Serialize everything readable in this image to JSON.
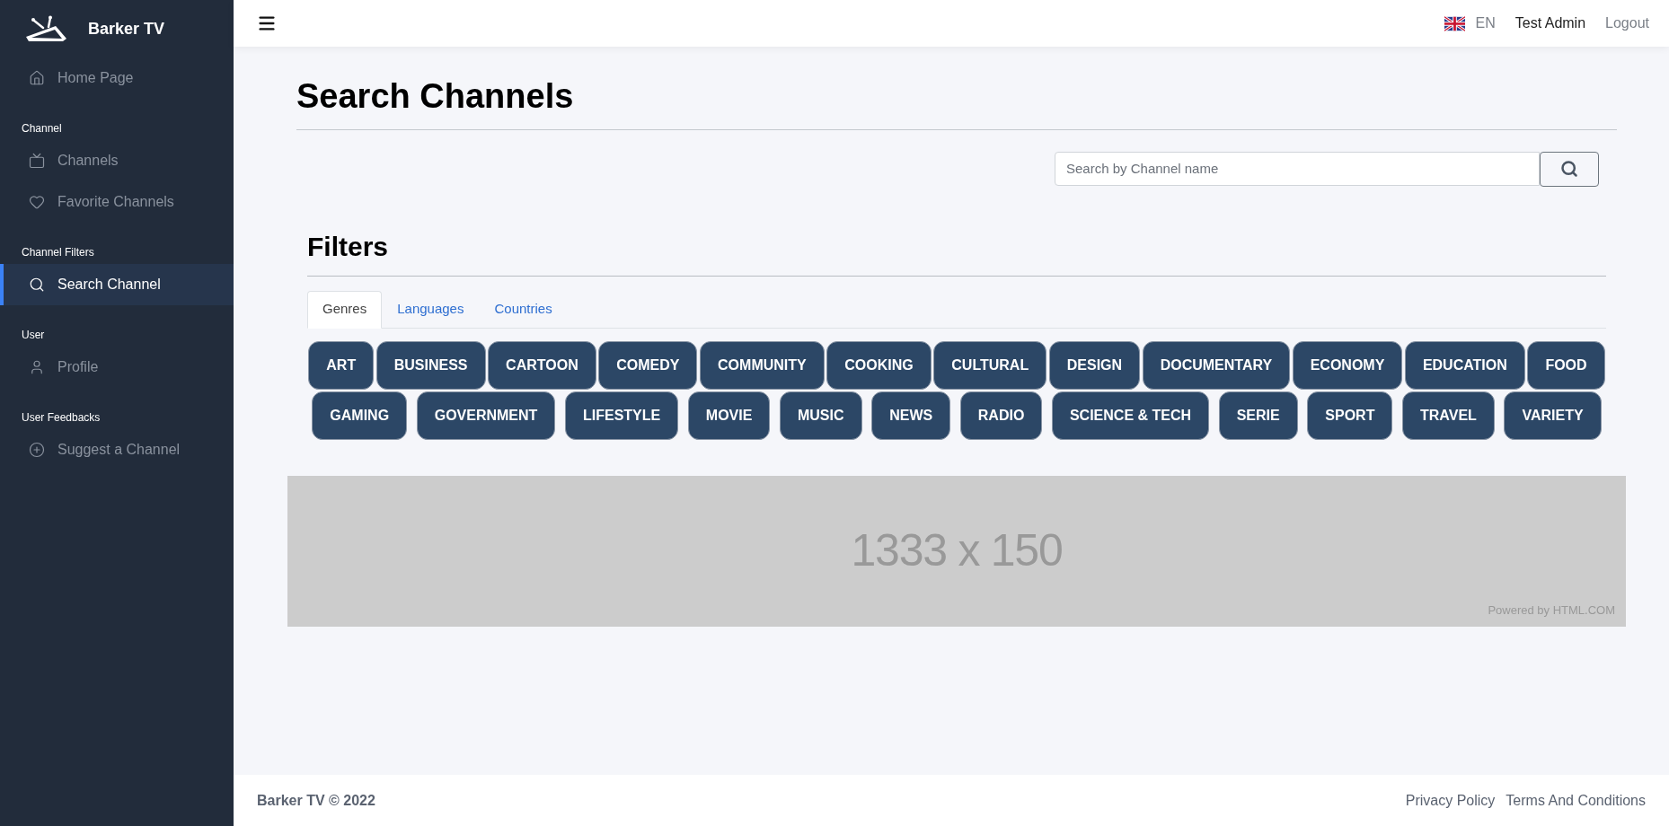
{
  "brand": {
    "name": "Barker TV"
  },
  "sidebar": [
    {
      "kind": "item",
      "label": "Home Page",
      "selected": false
    },
    {
      "kind": "section",
      "label": "Channel"
    },
    {
      "kind": "item",
      "label": "Channels",
      "selected": false
    },
    {
      "kind": "item",
      "label": "Favorite Channels",
      "selected": false
    },
    {
      "kind": "section",
      "label": "Channel Filters"
    },
    {
      "kind": "item",
      "label": "Search Channel",
      "selected": true
    },
    {
      "kind": "section",
      "label": "User"
    },
    {
      "kind": "item",
      "label": "Profile",
      "selected": false
    },
    {
      "kind": "section",
      "label": "User Feedbacks"
    },
    {
      "kind": "item",
      "label": "Suggest a Channel",
      "selected": false
    }
  ],
  "header": {
    "language": "EN",
    "user": "Test Admin",
    "logout": "Logout"
  },
  "page_title": "Search Channels",
  "search": {
    "placeholder": "Search by Channel name"
  },
  "filters": {
    "title": "Filters",
    "tabs": [
      {
        "label": "Genres",
        "selected": true
      },
      {
        "label": "Languages",
        "selected": false
      },
      {
        "label": "Countries",
        "selected": false
      }
    ],
    "genres": [
      "ART",
      "BUSINESS",
      "CARTOON",
      "COMEDY",
      "COMMUNITY",
      "COOKING",
      "CULTURAL",
      "DESIGN",
      "DOCUMENTARY",
      "ECONOMY",
      "EDUCATION",
      "FOOD",
      "GAMING",
      "GOVERNMENT",
      "LIFESTYLE",
      "MOVIE",
      "MUSIC",
      "NEWS",
      "RADIO",
      "SCIENCE & TECH",
      "SERIE",
      "SPORT",
      "TRAVEL",
      "VARIETY"
    ]
  },
  "banner": {
    "size": "1333 x 150",
    "credit": "Powered by HTML.COM"
  },
  "footer": {
    "copyright": "Barker TV © 2022",
    "links": [
      "Privacy Policy",
      "Terms And Conditions"
    ]
  }
}
